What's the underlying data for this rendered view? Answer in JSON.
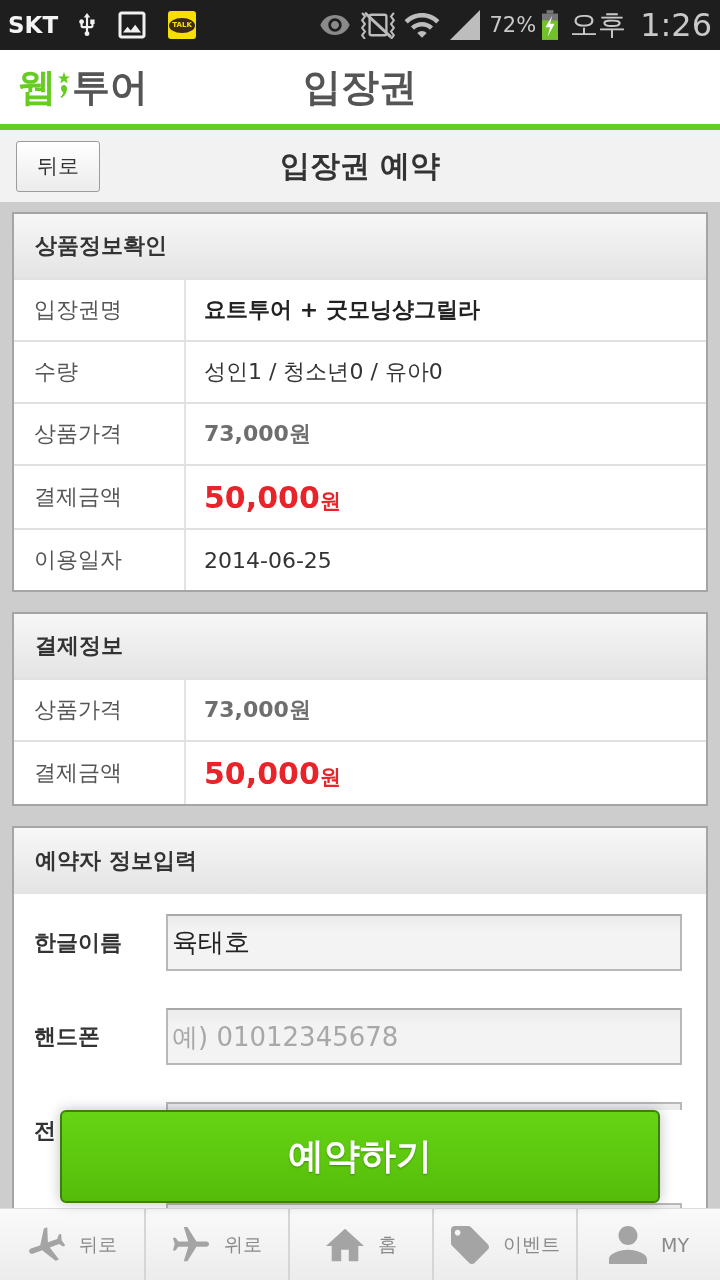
{
  "status_bar": {
    "carrier": "SKT",
    "chat_app_label": "TALK",
    "battery": "72%",
    "meridiem": "오후",
    "time": "1:26"
  },
  "header": {
    "logo_left": "웹",
    "logo_right": "투어",
    "title": "입장권"
  },
  "subheader": {
    "back_button": "뒤로",
    "title": "입장권 예약"
  },
  "sections": [
    {
      "title": "상품정보확인",
      "rows": [
        {
          "kind": "strong",
          "label": "입장권명",
          "value": "요트투어 + 굿모닝샹그릴라"
        },
        {
          "kind": "plain",
          "label": "수량",
          "value": "성인1 / 청소년0 / 유아0"
        },
        {
          "kind": "muted",
          "label": "상품가격",
          "value": "73,000원"
        },
        {
          "kind": "price",
          "label": "결제금액",
          "amount": "50,000",
          "unit": "원"
        },
        {
          "kind": "plain",
          "label": "이용일자",
          "value": "2014-06-25"
        }
      ]
    },
    {
      "title": "결제정보",
      "rows": [
        {
          "kind": "muted",
          "label": "상품가격",
          "value": "73,000원"
        },
        {
          "kind": "price",
          "label": "결제금액",
          "amount": "50,000",
          "unit": "원"
        }
      ]
    }
  ],
  "booker_form": {
    "title": "예약자 정보입력",
    "fields": [
      {
        "label": "한글이름",
        "value": "육태호",
        "partly_hidden": false
      },
      {
        "label": "핸드폰",
        "placeholder": "예) 01012345678",
        "partly_hidden": false
      },
      {
        "label": "전",
        "partly_hidden": true
      },
      {
        "partly_hidden": true
      }
    ]
  },
  "reserve_button": "예약하기",
  "bottom_nav": [
    {
      "label": "뒤로"
    },
    {
      "label": "위로"
    },
    {
      "label": "홈"
    },
    {
      "label": "이벤트"
    },
    {
      "label": "MY"
    }
  ]
}
